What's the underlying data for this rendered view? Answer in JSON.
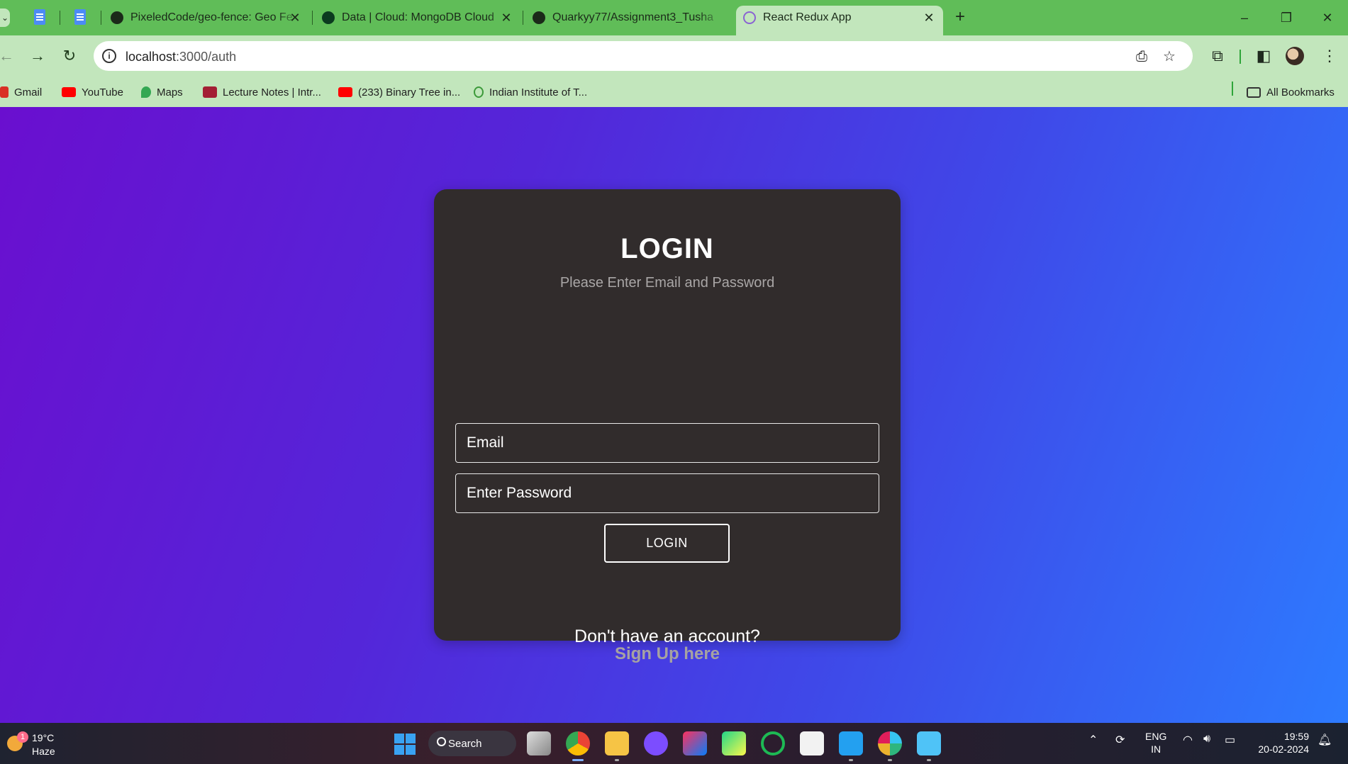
{
  "browser": {
    "tabs": [
      {
        "title": "PixeledCode/geo-fence: Geo Fe",
        "active": false
      },
      {
        "title": "Data | Cloud: MongoDB Cloud",
        "active": false
      },
      {
        "title": "Quarkyy77/Assignment3_Tusha",
        "active": false
      },
      {
        "title": "React Redux App",
        "active": true
      }
    ],
    "address": {
      "host": "localhost",
      "path": ":3000/auth"
    },
    "bookmarks": [
      {
        "label": "Gmail"
      },
      {
        "label": "YouTube"
      },
      {
        "label": "Maps"
      },
      {
        "label": "Lecture Notes | Intr..."
      },
      {
        "label": "(233) Binary Tree in..."
      },
      {
        "label": "Indian Institute of T..."
      }
    ],
    "all_bookmarks_label": "All Bookmarks",
    "theme_color": "#60bd58"
  },
  "login": {
    "title": "LOGIN",
    "subtitle": "Please Enter Email and Password",
    "email_placeholder": "Email",
    "password_placeholder": "Enter Password",
    "button_label": "LOGIN",
    "no_account_text": "Don't have an account?",
    "signup_link": "Sign Up here"
  },
  "taskbar": {
    "weather": {
      "badge": "1",
      "temp": "19°C",
      "condition": "Haze"
    },
    "search_label": "Search",
    "language": {
      "line1": "ENG",
      "line2": "IN"
    },
    "clock": {
      "time": "19:59",
      "date": "20-02-2024"
    }
  }
}
